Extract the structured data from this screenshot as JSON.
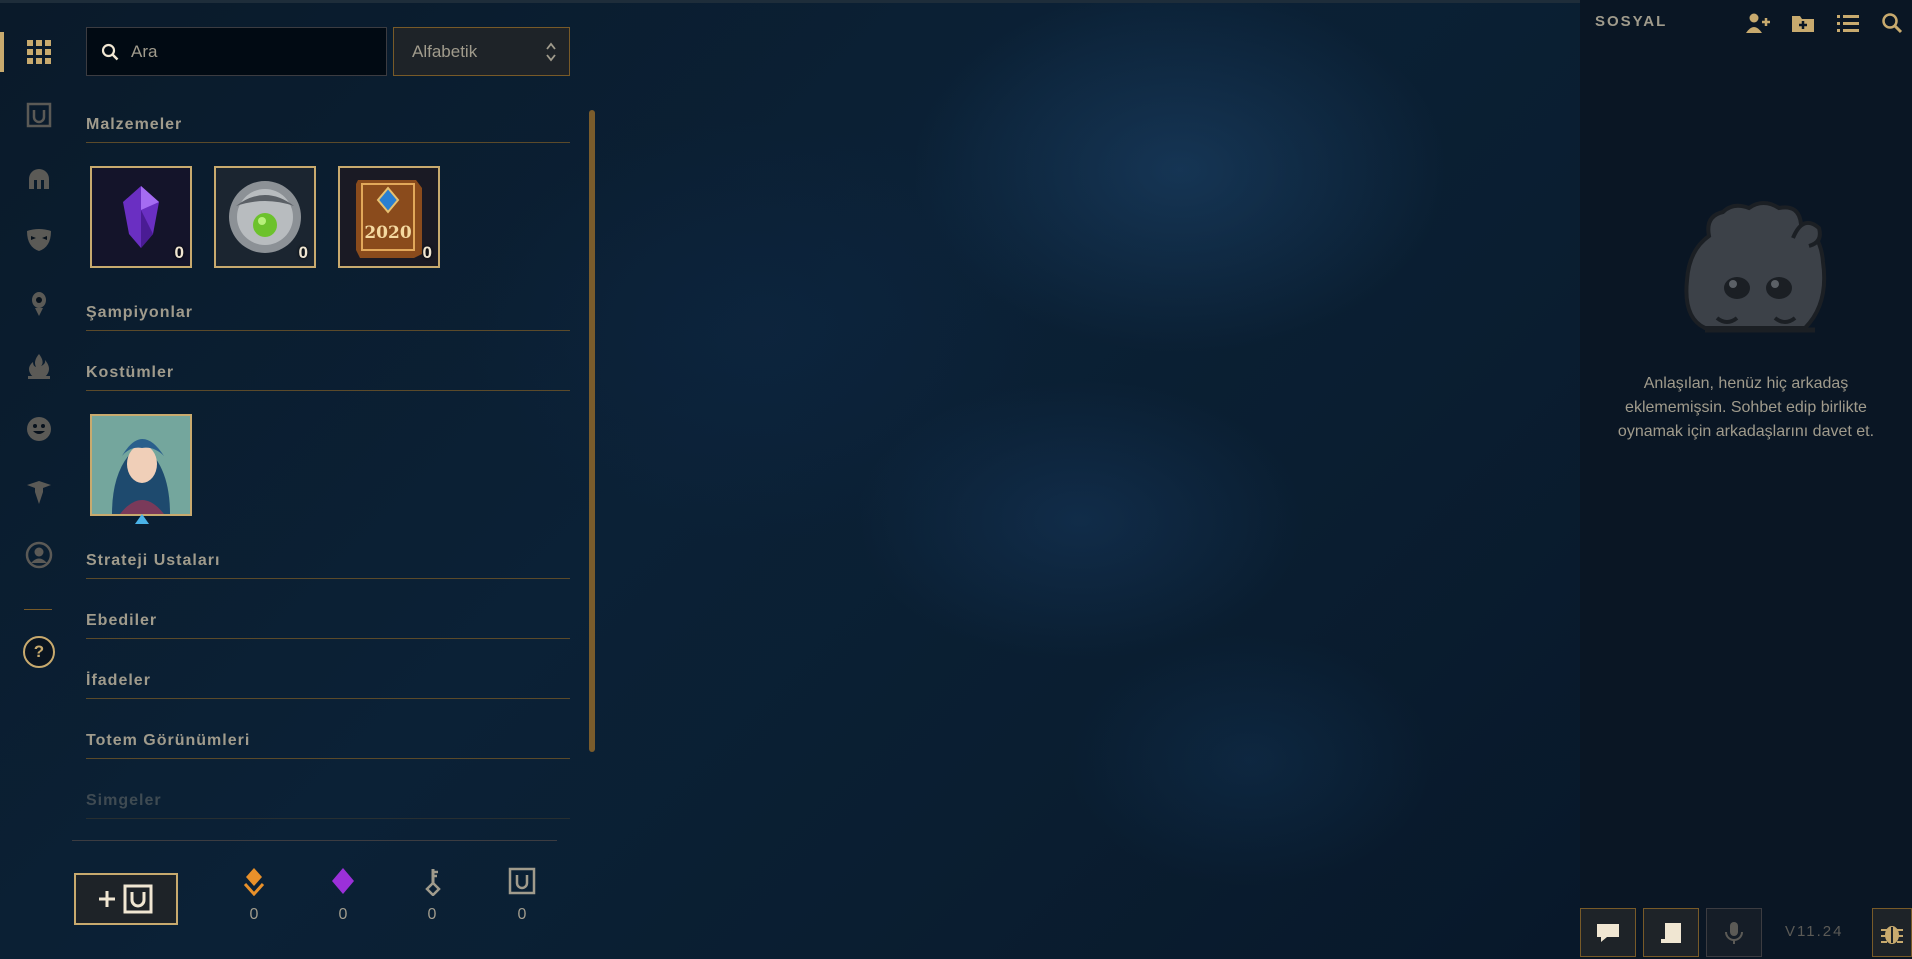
{
  "nav": {
    "items": [
      {
        "icon": "grid-icon"
      },
      {
        "icon": "chest-icon"
      },
      {
        "icon": "helmet-icon"
      },
      {
        "icon": "mask-icon"
      },
      {
        "icon": "ward-icon"
      },
      {
        "icon": "flame-icon"
      },
      {
        "icon": "emote-icon"
      },
      {
        "icon": "tft-icon"
      },
      {
        "icon": "profile-icon"
      }
    ],
    "help_label": "?"
  },
  "search": {
    "placeholder": "Ara",
    "value": ""
  },
  "sort": {
    "selected": "Alfabetik"
  },
  "inventory": {
    "categories": [
      {
        "title": "Malzemeler"
      },
      {
        "title": "Şampiyonlar"
      },
      {
        "title": "Kostümler"
      },
      {
        "title": "Strateji Ustaları"
      },
      {
        "title": "Ebediler"
      },
      {
        "title": "İfadeler"
      },
      {
        "title": "Totem Görünümleri"
      },
      {
        "title": "Simgeler"
      }
    ],
    "materials": [
      {
        "name": "purple-gem-icon",
        "count": "0"
      },
      {
        "name": "silver-orb-icon",
        "count": "0"
      },
      {
        "name": "2020-book-icon",
        "count": "0",
        "label": "2020"
      }
    ],
    "skins": [
      {
        "name": "champion-skin-portrait"
      }
    ]
  },
  "currencies": [
    {
      "icon": "orange-essence-icon",
      "value": "0",
      "color": "#e8902a"
    },
    {
      "icon": "mythic-essence-icon",
      "value": "0",
      "color": "#9b30d9"
    },
    {
      "icon": "key-icon",
      "value": "0",
      "color": "#a09b8c"
    },
    {
      "icon": "chest-icon",
      "value": "0",
      "color": "#a09b8c"
    }
  ],
  "social": {
    "title": "SOSYAL",
    "empty_message": "Anlaşılan, henüz hiç arkadaş eklememişsin. Sohbet edip birlikte oynamak için arkadaşlarını davet et.",
    "version": "V11.24"
  },
  "colors": {
    "gold": "#c8aa6e",
    "gold_dark": "#785a28",
    "text_muted": "#a09b8c",
    "panel_bg": "#0a1624"
  }
}
